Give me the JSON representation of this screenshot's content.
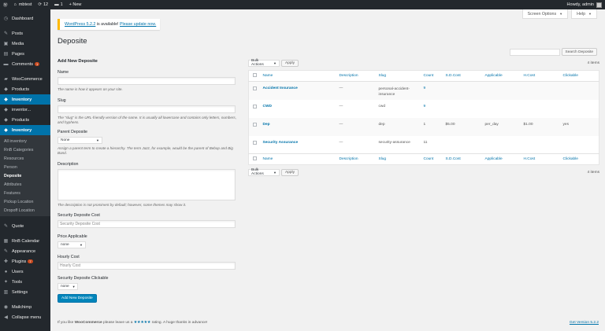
{
  "admin_bar": {
    "site_name": "mbtest",
    "updates_count": "12",
    "comments_count": "1",
    "new_label": "+ New",
    "greeting": "Howdy, admin"
  },
  "sidebar": {
    "dashboard": "Dashboard",
    "posts": "Posts",
    "media": "Media",
    "pages": "Pages",
    "comments": "Comments",
    "comments_badge": "1",
    "woocommerce": "WooCommerce",
    "products": "Products",
    "inventory": "Inventory",
    "inventor": "inventor...",
    "products2": "Products",
    "inventory2": "Inventory",
    "submenu": [
      "All inventory",
      "RnB Categories",
      "Resources",
      "Person",
      "Deposite",
      "Attributes",
      "Features",
      "Pickup Location",
      "Dropoff Location"
    ],
    "quote": "Quote",
    "rnb_calendar": "RnB Calendar",
    "appearance": "Appearance",
    "plugins": "Plugins",
    "plugins_badge": "7",
    "users": "Users",
    "tools": "Tools",
    "settings": "Settings",
    "mailchimp": "Mailchimp",
    "collapse": "Collapse menu"
  },
  "screen_options": "Screen Options",
  "help": "Help",
  "notice": {
    "link": "WordPress 5.2.2",
    "text": " is available! ",
    "update_link": "Please update now."
  },
  "page_title": "Deposite",
  "search": {
    "button": "Search Deposite"
  },
  "form": {
    "heading": "Add New Deposite",
    "name_label": "Name",
    "name_hint": "The name is how it appears on your site.",
    "slug_label": "Slug",
    "slug_hint": "The “slug” is the URL-friendly version of the name. It is usually all lowercase and contains only letters, numbers, and hyphens.",
    "parent_label": "Parent Deposite",
    "parent_value": "None",
    "parent_hint": "Assign a parent term to create a hierarchy. The term Jazz, for example, would be the parent of Bebop and Big Band.",
    "description_label": "Description",
    "description_hint": "The description is not prominent by default; however, some themes may show it.",
    "cost_label": "Security Deposite Cost",
    "cost_placeholder": "Security Deposite Cost",
    "price_label": "Price Applicable",
    "price_value": "none",
    "hourly_label": "Hourly Cost",
    "hourly_placeholder": "Hourly Cost",
    "clickable_label": "Security Deposite Clickable",
    "clickable_value": "none",
    "submit": "Add New Deposite"
  },
  "table": {
    "bulk_actions": "Bulk Actions",
    "apply": "Apply",
    "items_count": "4 items",
    "columns": [
      "Name",
      "Description",
      "Slug",
      "Count",
      "S.D.Cost",
      "Applicable",
      "H.Cost",
      "Clickable"
    ],
    "rows": [
      {
        "name": "Accident Insurance",
        "description": "—",
        "slug": "personal-accident-insurance",
        "count": "9",
        "cost": "",
        "applicable": "",
        "hcost": "",
        "clickable": ""
      },
      {
        "name": "CWD",
        "description": "—",
        "slug": "cwd",
        "count": "9",
        "cost": "",
        "applicable": "",
        "hcost": "",
        "clickable": ""
      },
      {
        "name": "Dep",
        "description": "—",
        "slug": "dep",
        "count": "1",
        "cost": "$5.00",
        "applicable": "per_day",
        "hcost": "$1.00",
        "clickable": "yes"
      },
      {
        "name": "Security Assurance",
        "description": "—",
        "slug": "security-assurance",
        "count": "11",
        "cost": "",
        "applicable": "",
        "hcost": "",
        "clickable": ""
      }
    ]
  },
  "footer": {
    "text_before": "If you like ",
    "brand": "WooCommerce",
    "text_mid": " please leave us a ",
    "stars": "★★★★★",
    "text_after": " rating. A huge thanks in advance!",
    "version": "Get Version 5.2.2"
  }
}
